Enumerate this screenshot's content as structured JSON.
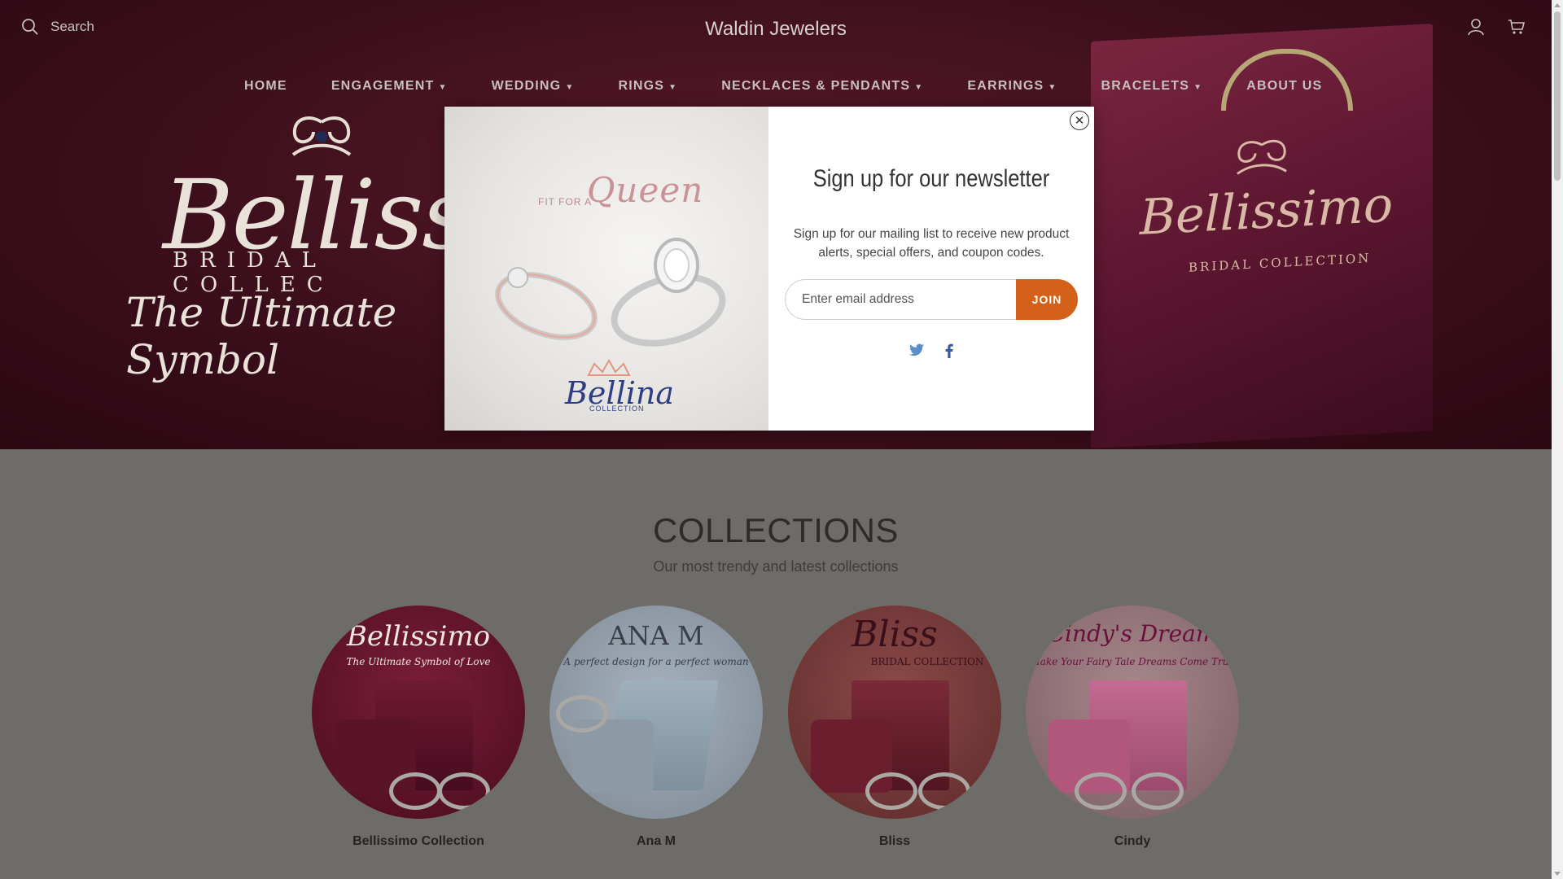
{
  "header": {
    "search_label": "Search",
    "brand": "Waldin Jewelers",
    "icons": [
      "search-icon",
      "user-icon",
      "cart-icon"
    ]
  },
  "nav": {
    "items": [
      {
        "label": "HOME",
        "dropdown": false
      },
      {
        "label": "ENGAGEMENT",
        "dropdown": true
      },
      {
        "label": "WEDDING",
        "dropdown": true
      },
      {
        "label": "RINGS",
        "dropdown": true
      },
      {
        "label": "NECKLACES & PENDANTS",
        "dropdown": true
      },
      {
        "label": "EARRINGS",
        "dropdown": true
      },
      {
        "label": "BRACELETS",
        "dropdown": true
      },
      {
        "label": "ABOUT US",
        "dropdown": false
      }
    ]
  },
  "hero": {
    "script": "Bellissim",
    "sub": "BRIDAL COLLEC",
    "tagline": "The Ultimate Symbol",
    "bag_script": "Bellissimo",
    "bag_sub": "BRIDAL COLLECTION"
  },
  "collections": {
    "title": "COLLECTIONS",
    "subtitle": "Our most trendy and latest collections",
    "items": [
      {
        "label": "Bellissimo Collection",
        "art_title": "Bellissimo",
        "art_sub": "The Ultimate Symbol of Love"
      },
      {
        "label": "Ana M",
        "art_title": "ANA M",
        "art_sub": "A perfect design for a perfect woman"
      },
      {
        "label": "Bliss",
        "art_title": "Bliss",
        "art_sub": "BRIDAL COLLECTION"
      },
      {
        "label": "Cindy",
        "art_title": "Cindy's Dream",
        "art_sub": "Make Your Fairy Tale Dreams Come True"
      }
    ]
  },
  "modal": {
    "image": {
      "fit": "FIT FOR A",
      "queen": "Queen",
      "brand": "Bellina",
      "brand_sub": "COLLECTION"
    },
    "close_icon": "close-icon",
    "title": "Sign up for our newsletter",
    "description": "Sign up for our mailing list to receive new product alerts, special offers, and coupon codes.",
    "email_placeholder": "Enter email address",
    "join_label": "JOIN",
    "social": [
      "twitter-icon",
      "facebook-icon"
    ],
    "accent": "#d3611a"
  }
}
